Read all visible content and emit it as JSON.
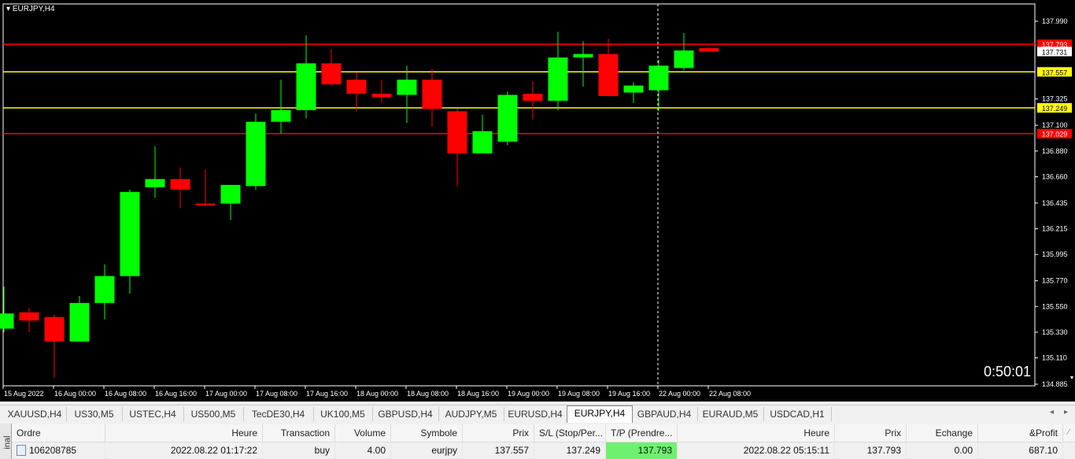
{
  "chart": {
    "title": "EURJPY,H4",
    "timer": "0:50:01",
    "colors": {
      "bull": "#00ff00",
      "bear": "#ff0000",
      "bg": "#000000",
      "sl_tp_line": "#ff0000",
      "entry_line": "#ffff00"
    },
    "price_labels": [
      "137.990",
      "137.325",
      "137.100",
      "136.880",
      "136.660",
      "136.435",
      "136.215",
      "135.995",
      "135.770",
      "135.550",
      "135.330",
      "135.110",
      "134.885"
    ],
    "time_labels": [
      "15 Aug 2022",
      "16 Aug 00:00",
      "16 Aug 08:00",
      "16 Aug 16:00",
      "17 Aug 00:00",
      "17 Aug 08:00",
      "17 Aug 16:00",
      "18 Aug 00:00",
      "18 Aug 08:00",
      "18 Aug 16:00",
      "19 Aug 00:00",
      "19 Aug 08:00",
      "19 Aug 16:00",
      "22 Aug 00:00",
      "22 Aug 08:00"
    ],
    "level_lines": [
      {
        "price": 137.793,
        "label": "137.793",
        "kind": "tp"
      },
      {
        "price": 137.557,
        "label": "137.557",
        "kind": "entry"
      },
      {
        "price": 137.249,
        "label": "137.249",
        "kind": "entry"
      },
      {
        "price": 137.029,
        "label": "137.029",
        "kind": "sl"
      }
    ],
    "current_price": {
      "price": 137.731,
      "label": "137.731"
    }
  },
  "chart_data": {
    "type": "candlestick",
    "title": "EURJPY,H4",
    "ylim": [
      134.885,
      138.07
    ],
    "candles": [
      {
        "o": 135.36,
        "h": 135.72,
        "l": 135.33,
        "c": 135.49
      },
      {
        "o": 135.5,
        "h": 135.54,
        "l": 135.33,
        "c": 135.43
      },
      {
        "o": 135.46,
        "h": 135.48,
        "l": 134.94,
        "c": 135.25
      },
      {
        "o": 135.25,
        "h": 135.64,
        "l": 135.25,
        "c": 135.58
      },
      {
        "o": 135.58,
        "h": 135.91,
        "l": 135.44,
        "c": 135.81
      },
      {
        "o": 135.81,
        "h": 136.55,
        "l": 135.66,
        "c": 136.53
      },
      {
        "o": 136.57,
        "h": 136.92,
        "l": 136.48,
        "c": 136.64
      },
      {
        "o": 136.64,
        "h": 136.74,
        "l": 136.39,
        "c": 136.55
      },
      {
        "o": 136.43,
        "h": 136.72,
        "l": 136.41,
        "c": 136.42
      },
      {
        "o": 136.43,
        "h": 136.59,
        "l": 136.29,
        "c": 136.59
      },
      {
        "o": 136.58,
        "h": 137.2,
        "l": 136.55,
        "c": 137.13
      },
      {
        "o": 137.13,
        "h": 137.49,
        "l": 137.03,
        "c": 137.23
      },
      {
        "o": 137.23,
        "h": 137.87,
        "l": 137.16,
        "c": 137.63
      },
      {
        "o": 137.63,
        "h": 137.75,
        "l": 137.44,
        "c": 137.45
      },
      {
        "o": 137.49,
        "h": 137.55,
        "l": 137.22,
        "c": 137.37
      },
      {
        "o": 137.37,
        "h": 137.49,
        "l": 137.29,
        "c": 137.34
      },
      {
        "o": 137.36,
        "h": 137.61,
        "l": 137.12,
        "c": 137.49
      },
      {
        "o": 137.49,
        "h": 137.58,
        "l": 137.09,
        "c": 137.24
      },
      {
        "o": 137.22,
        "h": 137.24,
        "l": 136.58,
        "c": 136.86
      },
      {
        "o": 136.86,
        "h": 137.19,
        "l": 136.86,
        "c": 137.05
      },
      {
        "o": 136.96,
        "h": 137.39,
        "l": 136.93,
        "c": 137.36
      },
      {
        "o": 137.37,
        "h": 137.48,
        "l": 137.15,
        "c": 137.31
      },
      {
        "o": 137.31,
        "h": 137.9,
        "l": 137.23,
        "c": 137.68
      },
      {
        "o": 137.68,
        "h": 137.82,
        "l": 137.43,
        "c": 137.71
      },
      {
        "o": 137.71,
        "h": 137.84,
        "l": 137.36,
        "c": 137.35
      },
      {
        "o": 137.38,
        "h": 137.47,
        "l": 137.29,
        "c": 137.44
      },
      {
        "o": 137.4,
        "h": 137.66,
        "l": 137.22,
        "c": 137.61
      },
      {
        "o": 137.59,
        "h": 137.89,
        "l": 137.57,
        "c": 137.74
      },
      {
        "o": 137.76,
        "h": 137.77,
        "l": 137.73,
        "c": 137.73
      }
    ]
  },
  "tabs": {
    "items": [
      "XAUUSD,H4",
      "US30,M5",
      "USTEC,H4",
      "US500,M5",
      "TecDE30,H4",
      "UK100,M5",
      "GBPUSD,H4",
      "AUDJPY,M5",
      "EURUSD,H4",
      "EURJPY,H4",
      "GBPAUD,H4",
      "EURAUD,M5",
      "USDCAD,H1"
    ],
    "active": "EURJPY,H4"
  },
  "terminal": {
    "side_label": "inal",
    "columns": [
      "Ordre",
      "Heure",
      "Transaction",
      "Volume",
      "Symbole",
      "Prix",
      "S/L (Stop/Per...",
      "T/P (Prendre...",
      "Heure",
      "Prix",
      "Echange",
      "&Profit"
    ],
    "row": {
      "order": "106208785",
      "open_time": "2022.08.22 01:17:22",
      "type": "buy",
      "volume": "4.00",
      "symbol": "eurjpy",
      "price": "137.557",
      "sl": "137.249",
      "tp": "137.793",
      "close_time": "2022.08.22 05:15:11",
      "close_price": "137.793",
      "swap": "0.00",
      "profit": "687.10"
    }
  }
}
